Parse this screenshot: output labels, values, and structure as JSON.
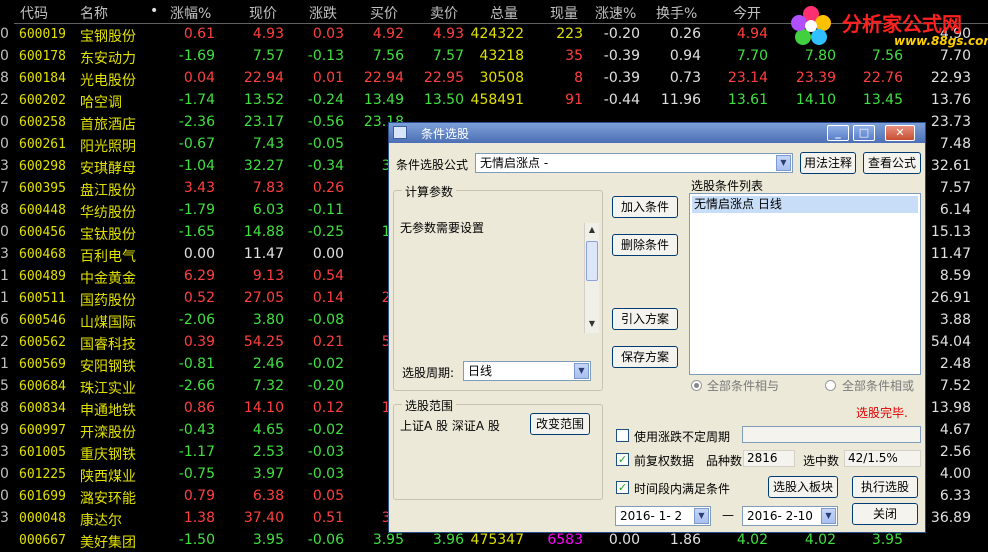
{
  "table": {
    "headers": [
      "代码",
      "名称",
      "•",
      "涨幅%",
      "现价",
      "涨跌",
      "买价",
      "卖价",
      "总量",
      "现量",
      "涨速%",
      "换手%",
      "今开"
    ],
    "rows": [
      {
        "code": "600019",
        "name": "宝钢股份",
        "pct": "0.61",
        "price": "4.93",
        "chg": "0.03",
        "buy": "4.92",
        "sell": "4.93",
        "vol": "424322",
        "cur": "223",
        "spd": "-0.20",
        "turn": "0.26",
        "open": "4.94",
        "hi": "",
        "lo": "",
        "prev": "4.90",
        "dir": "up",
        "curdir": "yel"
      },
      {
        "code": "600178",
        "name": "东安动力",
        "pct": "-1.69",
        "price": "7.57",
        "chg": "-0.13",
        "buy": "7.56",
        "sell": "7.57",
        "vol": "43218",
        "cur": "35",
        "spd": "-0.39",
        "turn": "0.94",
        "open": "7.70",
        "hi": "7.80",
        "lo": "7.56",
        "prev": "7.70",
        "dir": "down",
        "curdir": "up"
      },
      {
        "code": "600184",
        "name": "光电股份",
        "pct": "0.04",
        "price": "22.94",
        "chg": "0.01",
        "buy": "22.94",
        "sell": "22.95",
        "vol": "30508",
        "cur": "8",
        "spd": "-0.39",
        "turn": "0.73",
        "open": "23.14",
        "hi": "23.39",
        "lo": "22.76",
        "prev": "22.93",
        "dir": "up",
        "curdir": "up"
      },
      {
        "code": "600202",
        "name": "哈空调",
        "pct": "-1.74",
        "price": "13.52",
        "chg": "-0.24",
        "buy": "13.49",
        "sell": "13.50",
        "vol": "458491",
        "cur": "91",
        "spd": "-0.44",
        "turn": "11.96",
        "open": "13.61",
        "hi": "14.10",
        "lo": "13.45",
        "prev": "13.76",
        "dir": "down",
        "curdir": "up"
      },
      {
        "code": "600258",
        "name": "首旅酒店",
        "pct": "-2.36",
        "price": "23.17",
        "chg": "-0.56",
        "buy": "23.18",
        "sell": "",
        "vol": "",
        "cur": "",
        "spd": "",
        "turn": "",
        "open": "",
        "hi": "",
        "lo": "",
        "prev": "23.73",
        "dir": "down",
        "curdir": "up"
      },
      {
        "code": "600261",
        "name": "阳光照明",
        "pct": "-0.67",
        "price": "7.43",
        "chg": "-0.05",
        "buy": "7.",
        "sell": "",
        "vol": "",
        "cur": "",
        "spd": "",
        "turn": "",
        "open": "",
        "hi": "",
        "lo": "",
        "prev": "7.48",
        "dir": "down",
        "curdir": "up"
      },
      {
        "code": "600298",
        "name": "安琪酵母",
        "pct": "-1.04",
        "price": "32.27",
        "chg": "-0.34",
        "buy": "32.",
        "sell": "",
        "vol": "",
        "cur": "",
        "spd": "",
        "turn": "",
        "open": "",
        "hi": "",
        "lo": "",
        "prev": "32.61",
        "dir": "down",
        "curdir": "up"
      },
      {
        "code": "600395",
        "name": "盘江股份",
        "pct": "3.43",
        "price": "7.83",
        "chg": "0.26",
        "buy": "7.",
        "sell": "",
        "vol": "",
        "cur": "",
        "spd": "",
        "turn": "",
        "open": "",
        "hi": "",
        "lo": "",
        "prev": "7.57",
        "dir": "up",
        "curdir": "up"
      },
      {
        "code": "600448",
        "name": "华纺股份",
        "pct": "-1.79",
        "price": "6.03",
        "chg": "-0.11",
        "buy": "6.",
        "sell": "",
        "vol": "",
        "cur": "",
        "spd": "",
        "turn": "",
        "open": "",
        "hi": "",
        "lo": "",
        "prev": "6.14",
        "dir": "down",
        "curdir": "up"
      },
      {
        "code": "600456",
        "name": "宝钛股份",
        "pct": "-1.65",
        "price": "14.88",
        "chg": "-0.25",
        "buy": "14.",
        "sell": "",
        "vol": "",
        "cur": "",
        "spd": "",
        "turn": "",
        "open": "",
        "hi": "",
        "lo": "",
        "prev": "15.13",
        "dir": "down",
        "curdir": "up"
      },
      {
        "code": "600468",
        "name": "百利电气",
        "pct": "0.00",
        "price": "11.47",
        "chg": "0.00",
        "buy": "",
        "sell": "",
        "vol": "",
        "cur": "",
        "spd": "",
        "turn": "",
        "open": "",
        "hi": "",
        "lo": "",
        "prev": "11.47",
        "dir": "flat",
        "curdir": "up"
      },
      {
        "code": "600489",
        "name": "中金黄金",
        "pct": "6.29",
        "price": "9.13",
        "chg": "0.54",
        "buy": "9.",
        "sell": "",
        "vol": "",
        "cur": "",
        "spd": "",
        "turn": "",
        "open": "",
        "hi": "",
        "lo": "",
        "prev": "8.59",
        "dir": "up",
        "curdir": "up"
      },
      {
        "code": "600511",
        "name": "国药股份",
        "pct": "0.52",
        "price": "27.05",
        "chg": "0.14",
        "buy": "27.",
        "sell": "",
        "vol": "",
        "cur": "",
        "spd": "",
        "turn": "",
        "open": "",
        "hi": "",
        "lo": "",
        "prev": "26.91",
        "dir": "up",
        "curdir": "up"
      },
      {
        "code": "600546",
        "name": "山煤国际",
        "pct": "-2.06",
        "price": "3.80",
        "chg": "-0.08",
        "buy": "3.",
        "sell": "",
        "vol": "",
        "cur": "",
        "spd": "",
        "turn": "",
        "open": "",
        "hi": "",
        "lo": "",
        "prev": "3.88",
        "dir": "down",
        "curdir": "up"
      },
      {
        "code": "600562",
        "name": "国睿科技",
        "pct": "0.39",
        "price": "54.25",
        "chg": "0.21",
        "buy": "54.",
        "sell": "",
        "vol": "",
        "cur": "",
        "spd": "",
        "turn": "",
        "open": "",
        "hi": "",
        "lo": "",
        "prev": "54.04",
        "dir": "up",
        "curdir": "up"
      },
      {
        "code": "600569",
        "name": "安阳钢铁",
        "pct": "-0.81",
        "price": "2.46",
        "chg": "-0.02",
        "buy": "2.",
        "sell": "",
        "vol": "",
        "cur": "",
        "spd": "",
        "turn": "",
        "open": "",
        "hi": "",
        "lo": "",
        "prev": "2.48",
        "dir": "down",
        "curdir": "up"
      },
      {
        "code": "600684",
        "name": "珠江实业",
        "pct": "-2.66",
        "price": "7.32",
        "chg": "-0.20",
        "buy": "7.",
        "sell": "",
        "vol": "",
        "cur": "",
        "spd": "",
        "turn": "",
        "open": "",
        "hi": "",
        "lo": "",
        "prev": "7.52",
        "dir": "down",
        "curdir": "up"
      },
      {
        "code": "600834",
        "name": "申通地铁",
        "pct": "0.86",
        "price": "14.10",
        "chg": "0.12",
        "buy": "14.",
        "sell": "",
        "vol": "",
        "cur": "",
        "spd": "",
        "turn": "",
        "open": "",
        "hi": "",
        "lo": "",
        "prev": "13.98",
        "dir": "up",
        "curdir": "up"
      },
      {
        "code": "600997",
        "name": "开滦股份",
        "pct": "-0.43",
        "price": "4.65",
        "chg": "-0.02",
        "buy": "4.",
        "sell": "",
        "vol": "",
        "cur": "",
        "spd": "",
        "turn": "",
        "open": "",
        "hi": "",
        "lo": "",
        "prev": "4.67",
        "dir": "down",
        "curdir": "up"
      },
      {
        "code": "601005",
        "name": "重庆钢铁",
        "pct": "-1.17",
        "price": "2.53",
        "chg": "-0.03",
        "buy": "2.",
        "sell": "",
        "vol": "",
        "cur": "",
        "spd": "",
        "turn": "",
        "open": "",
        "hi": "",
        "lo": "",
        "prev": "2.56",
        "dir": "down",
        "curdir": "up"
      },
      {
        "code": "601225",
        "name": "陕西煤业",
        "pct": "-0.75",
        "price": "3.97",
        "chg": "-0.03",
        "buy": "3.",
        "sell": "",
        "vol": "",
        "cur": "",
        "spd": "",
        "turn": "",
        "open": "",
        "hi": "",
        "lo": "",
        "prev": "4.00",
        "dir": "down",
        "curdir": "up"
      },
      {
        "code": "601699",
        "name": "潞安环能",
        "pct": "0.79",
        "price": "6.38",
        "chg": "0.05",
        "buy": "6.",
        "sell": "",
        "vol": "",
        "cur": "",
        "spd": "",
        "turn": "",
        "open": "",
        "hi": "",
        "lo": "",
        "prev": "6.33",
        "dir": "up",
        "curdir": "up"
      },
      {
        "code": "000048",
        "name": "康达尔",
        "pct": "1.38",
        "price": "37.40",
        "chg": "0.51",
        "buy": "37.",
        "sell": "",
        "vol": "",
        "cur": "",
        "spd": "",
        "turn": "",
        "open": "",
        "hi": "",
        "lo": "",
        "prev": "36.89",
        "dir": "up",
        "curdir": "up"
      },
      {
        "code": "000667",
        "name": "美好集团",
        "pct": "-1.50",
        "price": "3.95",
        "chg": "-0.06",
        "buy": "3.95",
        "sell": "3.96",
        "vol": "475347",
        "cur": "6583",
        "spd": "0.00",
        "turn": "1.86",
        "open": "4.02",
        "hi": "4.02",
        "lo": "3.95",
        "prev": "",
        "dir": "down",
        "curdir": "mag"
      }
    ],
    "left_marks": [
      "0",
      "0",
      "8",
      "2",
      "0",
      "0",
      "3",
      "7",
      "8",
      "0",
      "3",
      "1",
      "1",
      "6",
      "2",
      "1",
      "5",
      "8",
      "9",
      "3",
      "0",
      "0",
      "3"
    ]
  },
  "logo": {
    "brand": "分析家公式网",
    "url": "www.88gs.com"
  },
  "dialog": {
    "title": "条件选股",
    "formula_label": "条件选股公式",
    "formula_value": "无情启涨点  -",
    "usage_button": "用法注释",
    "view_button": "查看公式",
    "params_group": "计算参数",
    "params_text": "无参数需要设置",
    "add_button": "加入条件",
    "delete_button": "删除条件",
    "import_button": "引入方案",
    "save_button": "保存方案",
    "list_title": "选股条件列表",
    "list_items": [
      "无情启涨点   日线"
    ],
    "period_label": "选股周期:",
    "period_value": "日线",
    "radio_all": "全部条件相与",
    "radio_any": "全部条件相或",
    "status_text": "选股完毕.",
    "range_group": "选股范围",
    "range_text": "上证A 股  深证A 股",
    "change_range_button": "改变范围",
    "use_period_label": "使用涨跌不定周期",
    "use_period_checked": false,
    "prefuquan_label": "前复权数据",
    "prefuquan_checked": true,
    "count_label": "品种数",
    "count_value": "2816",
    "selected_label": "选中数",
    "selected_value": "42/1.5%",
    "range_time_label": "时间段内满足条件",
    "range_time_checked": true,
    "to_board_button": "选股入板块",
    "execute_button": "执行选股",
    "date_from": "2016- 1- 2",
    "date_sep": "—",
    "date_to": "2016- 2-10",
    "close_button": "关闭",
    "minimize_glyph": "_",
    "maximize_glyph": "□",
    "close_glyph": "✕"
  }
}
